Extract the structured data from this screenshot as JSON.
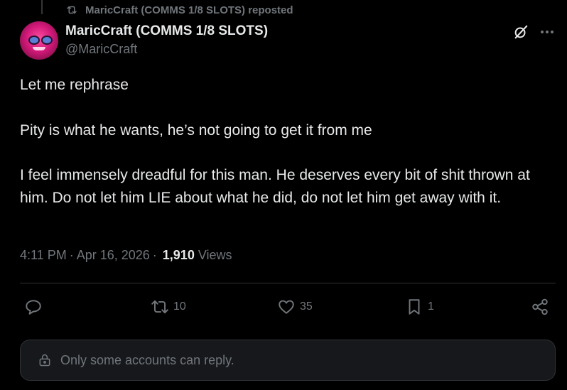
{
  "repost": {
    "label": "MaricCraft (COMMS 1/8 SLOTS) reposted",
    "icon": "repost-icon"
  },
  "author": {
    "display_name": "MaricCraft (COMMS 1/8 SLOTS)",
    "handle": "@MaricCraft",
    "avatar_color": "#d3197a"
  },
  "header_actions": {
    "grok_icon": "grok-icon",
    "more_icon": "more-icon"
  },
  "post": {
    "paragraphs": [
      "Let me rephrase",
      "Pity is what he wants, he’s not going to get it from me",
      "I feel immensely dreadful for this man. He deserves every bit of shit thrown at him. Do not let him LIE about what he did, do not let him get away with it."
    ]
  },
  "meta": {
    "time": "4:11 PM",
    "separator": "·",
    "date": "Apr 16, 2026",
    "views_count": "1,910",
    "views_label": "Views"
  },
  "actions": {
    "reply_count": "",
    "repost_count": "10",
    "like_count": "35",
    "bookmark_count": "1",
    "share_icon": "share-icon"
  },
  "reply_restriction": {
    "text": "Only some accounts can reply.",
    "icon": "lock-icon"
  },
  "colors": {
    "background": "#000000",
    "text_primary": "#e7e9ea",
    "text_secondary": "#71767b",
    "divider": "#2f3336",
    "reply_box_bg": "#16181c"
  }
}
